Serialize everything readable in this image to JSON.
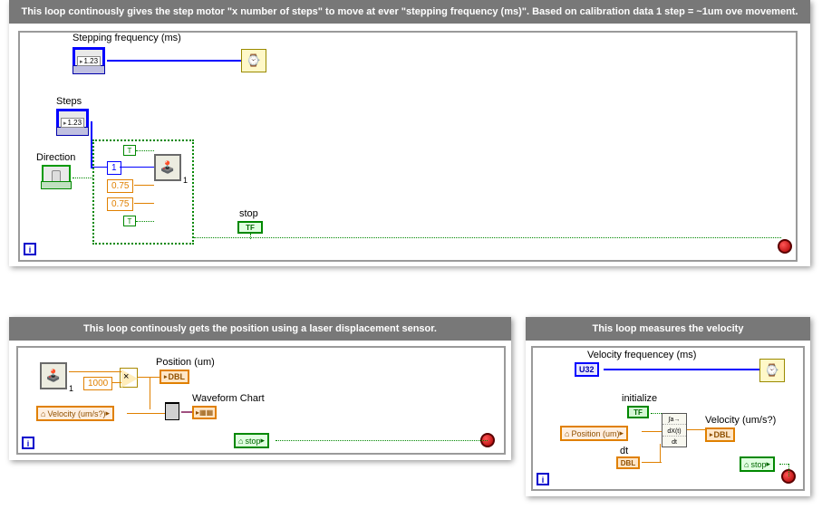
{
  "panel1": {
    "header": "This loop continously gives the step motor \"x number of steps\" to move at ever \"stepping frequency (ms)\". Based on calibration data 1 step = ~1um ove movement.",
    "stepping_freq_label": "Stepping frequency (ms)",
    "stepping_freq_value": "1.23",
    "steps_label": "Steps",
    "steps_value": "1.23",
    "direction_label": "Direction",
    "const_one": "1",
    "const_a": "0.75",
    "const_b": "0.75",
    "const_t1": "T",
    "const_t2": "T",
    "subvi_index": "1",
    "stop_label": "stop",
    "stop_tf": "TF",
    "i_label": "i"
  },
  "panel2": {
    "header": "This loop continously gets the position using a laser displacement sensor.",
    "subvi_index": "1",
    "const_1000": "1000",
    "position_label": "Position (um)",
    "position_type": "DBL",
    "chart_label": "Waveform Chart",
    "velocity_local": "Velocity (um/s?)",
    "stop_local": "stop",
    "i_label": "i"
  },
  "panel3": {
    "header": "This loop measures the velocity",
    "vfreq_label": "Velocity frequencey (ms)",
    "u32": "U32",
    "initialize_label": "initialize",
    "init_tf": "TF",
    "position_local": "Position (um)",
    "velocity_label": "Velocity (um/s?)",
    "velocity_type": "DBL",
    "dt_label": "dt",
    "dt_type": "DBL",
    "dxdt_top": "∫a→",
    "dxdt_mid": "dX(t)",
    "dxdt_bot": "dt",
    "stop_local": "stop",
    "i_label": "i"
  }
}
